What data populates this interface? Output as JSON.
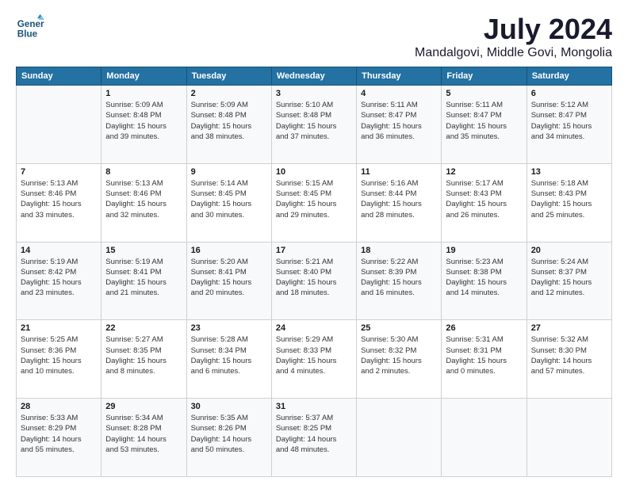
{
  "logo": {
    "line1": "General",
    "line2": "Blue"
  },
  "title": "July 2024",
  "subtitle": "Mandalgovi, Middle Govi, Mongolia",
  "weekdays": [
    "Sunday",
    "Monday",
    "Tuesday",
    "Wednesday",
    "Thursday",
    "Friday",
    "Saturday"
  ],
  "weeks": [
    [
      {
        "day": "",
        "info": ""
      },
      {
        "day": "1",
        "info": "Sunrise: 5:09 AM\nSunset: 8:48 PM\nDaylight: 15 hours\nand 39 minutes."
      },
      {
        "day": "2",
        "info": "Sunrise: 5:09 AM\nSunset: 8:48 PM\nDaylight: 15 hours\nand 38 minutes."
      },
      {
        "day": "3",
        "info": "Sunrise: 5:10 AM\nSunset: 8:48 PM\nDaylight: 15 hours\nand 37 minutes."
      },
      {
        "day": "4",
        "info": "Sunrise: 5:11 AM\nSunset: 8:47 PM\nDaylight: 15 hours\nand 36 minutes."
      },
      {
        "day": "5",
        "info": "Sunrise: 5:11 AM\nSunset: 8:47 PM\nDaylight: 15 hours\nand 35 minutes."
      },
      {
        "day": "6",
        "info": "Sunrise: 5:12 AM\nSunset: 8:47 PM\nDaylight: 15 hours\nand 34 minutes."
      }
    ],
    [
      {
        "day": "7",
        "info": "Sunrise: 5:13 AM\nSunset: 8:46 PM\nDaylight: 15 hours\nand 33 minutes."
      },
      {
        "day": "8",
        "info": "Sunrise: 5:13 AM\nSunset: 8:46 PM\nDaylight: 15 hours\nand 32 minutes."
      },
      {
        "day": "9",
        "info": "Sunrise: 5:14 AM\nSunset: 8:45 PM\nDaylight: 15 hours\nand 30 minutes."
      },
      {
        "day": "10",
        "info": "Sunrise: 5:15 AM\nSunset: 8:45 PM\nDaylight: 15 hours\nand 29 minutes."
      },
      {
        "day": "11",
        "info": "Sunrise: 5:16 AM\nSunset: 8:44 PM\nDaylight: 15 hours\nand 28 minutes."
      },
      {
        "day": "12",
        "info": "Sunrise: 5:17 AM\nSunset: 8:43 PM\nDaylight: 15 hours\nand 26 minutes."
      },
      {
        "day": "13",
        "info": "Sunrise: 5:18 AM\nSunset: 8:43 PM\nDaylight: 15 hours\nand 25 minutes."
      }
    ],
    [
      {
        "day": "14",
        "info": "Sunrise: 5:19 AM\nSunset: 8:42 PM\nDaylight: 15 hours\nand 23 minutes."
      },
      {
        "day": "15",
        "info": "Sunrise: 5:19 AM\nSunset: 8:41 PM\nDaylight: 15 hours\nand 21 minutes."
      },
      {
        "day": "16",
        "info": "Sunrise: 5:20 AM\nSunset: 8:41 PM\nDaylight: 15 hours\nand 20 minutes."
      },
      {
        "day": "17",
        "info": "Sunrise: 5:21 AM\nSunset: 8:40 PM\nDaylight: 15 hours\nand 18 minutes."
      },
      {
        "day": "18",
        "info": "Sunrise: 5:22 AM\nSunset: 8:39 PM\nDaylight: 15 hours\nand 16 minutes."
      },
      {
        "day": "19",
        "info": "Sunrise: 5:23 AM\nSunset: 8:38 PM\nDaylight: 15 hours\nand 14 minutes."
      },
      {
        "day": "20",
        "info": "Sunrise: 5:24 AM\nSunset: 8:37 PM\nDaylight: 15 hours\nand 12 minutes."
      }
    ],
    [
      {
        "day": "21",
        "info": "Sunrise: 5:25 AM\nSunset: 8:36 PM\nDaylight: 15 hours\nand 10 minutes."
      },
      {
        "day": "22",
        "info": "Sunrise: 5:27 AM\nSunset: 8:35 PM\nDaylight: 15 hours\nand 8 minutes."
      },
      {
        "day": "23",
        "info": "Sunrise: 5:28 AM\nSunset: 8:34 PM\nDaylight: 15 hours\nand 6 minutes."
      },
      {
        "day": "24",
        "info": "Sunrise: 5:29 AM\nSunset: 8:33 PM\nDaylight: 15 hours\nand 4 minutes."
      },
      {
        "day": "25",
        "info": "Sunrise: 5:30 AM\nSunset: 8:32 PM\nDaylight: 15 hours\nand 2 minutes."
      },
      {
        "day": "26",
        "info": "Sunrise: 5:31 AM\nSunset: 8:31 PM\nDaylight: 15 hours\nand 0 minutes."
      },
      {
        "day": "27",
        "info": "Sunrise: 5:32 AM\nSunset: 8:30 PM\nDaylight: 14 hours\nand 57 minutes."
      }
    ],
    [
      {
        "day": "28",
        "info": "Sunrise: 5:33 AM\nSunset: 8:29 PM\nDaylight: 14 hours\nand 55 minutes."
      },
      {
        "day": "29",
        "info": "Sunrise: 5:34 AM\nSunset: 8:28 PM\nDaylight: 14 hours\nand 53 minutes."
      },
      {
        "day": "30",
        "info": "Sunrise: 5:35 AM\nSunset: 8:26 PM\nDaylight: 14 hours\nand 50 minutes."
      },
      {
        "day": "31",
        "info": "Sunrise: 5:37 AM\nSunset: 8:25 PM\nDaylight: 14 hours\nand 48 minutes."
      },
      {
        "day": "",
        "info": ""
      },
      {
        "day": "",
        "info": ""
      },
      {
        "day": "",
        "info": ""
      }
    ]
  ]
}
